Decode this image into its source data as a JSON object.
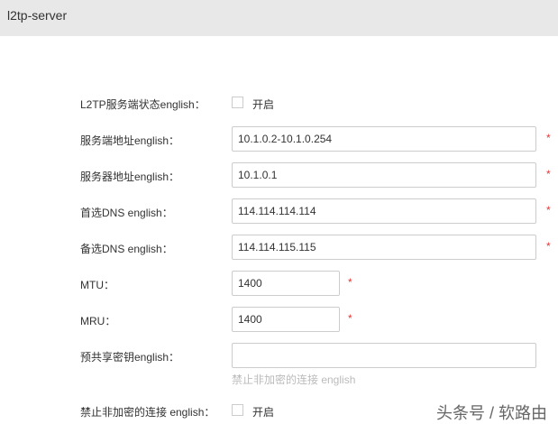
{
  "header": {
    "title": "l2tp-server"
  },
  "form": {
    "status": {
      "label": "L2TP服务端状态english：",
      "option": "开启"
    },
    "server_range": {
      "label": "服务端地址english：",
      "value": "10.1.0.2-10.1.0.254",
      "required": "*"
    },
    "server_addr": {
      "label": "服务器地址english：",
      "value": "10.1.0.1",
      "required": "*"
    },
    "dns1": {
      "label": "首选DNS english：",
      "value": "114.114.114.114",
      "required": "*"
    },
    "dns2": {
      "label": "备选DNS english：",
      "value": "114.114.115.115",
      "required": "*"
    },
    "mtu": {
      "label": "MTU：",
      "value": "1400",
      "required": "*"
    },
    "mru": {
      "label": "MRU：",
      "value": "1400",
      "required": "*"
    },
    "psk": {
      "label": "预共享密钥english：",
      "value": "",
      "hint": "禁止非加密的连接 english"
    },
    "no_unencrypted": {
      "label": "禁止非加密的连接 english：",
      "option": "开启"
    }
  },
  "watermark": "头条号 / 软路由"
}
